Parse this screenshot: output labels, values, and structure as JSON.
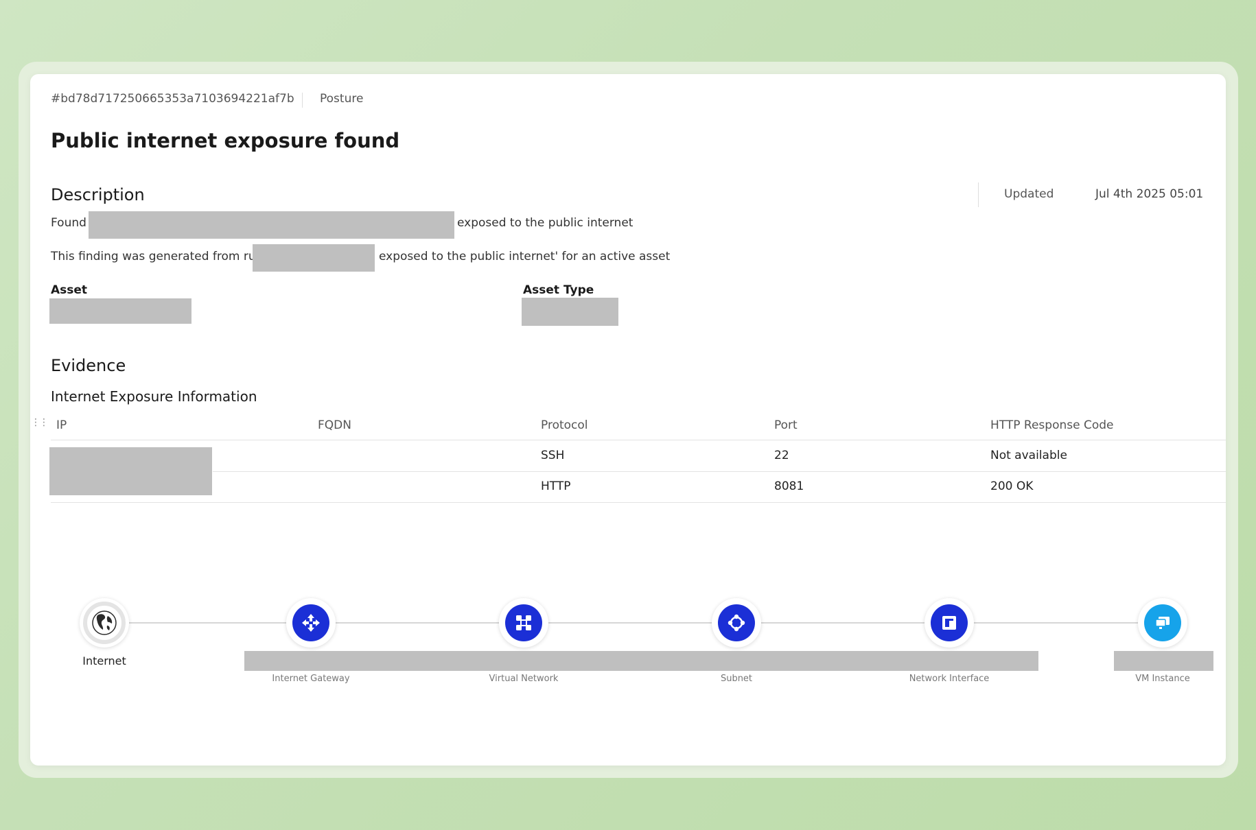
{
  "header": {
    "finding_id": "#bd78d717250665353a7103694221af7b",
    "category": "Posture",
    "title": "Public internet exposure found"
  },
  "description": {
    "heading": "Description",
    "updated_label": "Updated",
    "updated_value": "Jul 4th 2025 05:01",
    "line1_prefix": "Found",
    "line1_suffix": "exposed to the public internet",
    "line2_prefix": "This finding was generated from rule",
    "line2_suffix": "exposed to the public internet' for an active asset",
    "asset_label": "Asset",
    "asset_type_label": "Asset Type"
  },
  "evidence": {
    "heading": "Evidence",
    "subheading": "Internet Exposure Information",
    "columns": [
      "IP",
      "FQDN",
      "Protocol",
      "Port",
      "HTTP Response Code"
    ],
    "rows": [
      {
        "protocol": "SSH",
        "port": "22",
        "response": "Not available"
      },
      {
        "protocol": "HTTP",
        "port": "8081",
        "response": "200 OK"
      }
    ]
  },
  "path": {
    "nodes": [
      {
        "label": "Internet",
        "icon": "globe-icon",
        "color": "#2b2b2b"
      },
      {
        "label": "Internet Gateway",
        "icon": "gateway-icon",
        "color": "#1b2fd6"
      },
      {
        "label": "Virtual Network",
        "icon": "network-icon",
        "color": "#1b2fd6"
      },
      {
        "label": "Subnet",
        "icon": "subnet-icon",
        "color": "#1b2fd6"
      },
      {
        "label": "Network Interface",
        "icon": "nic-icon",
        "color": "#1b2fd6"
      },
      {
        "label": "VM Instance",
        "icon": "vm-icon",
        "color": "#16a3ea"
      }
    ]
  }
}
